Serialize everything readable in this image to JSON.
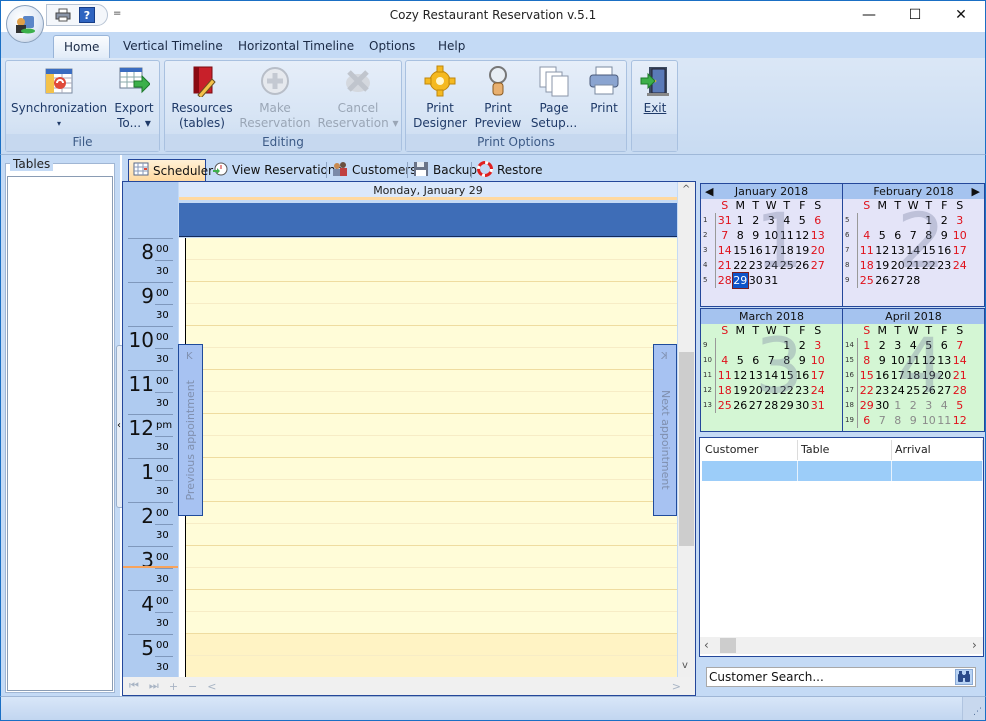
{
  "window": {
    "title": "Cozy Restaurant Reservation v.5.1",
    "controls": {
      "minimize": "—",
      "maximize": "☐",
      "close": "✕"
    }
  },
  "quick_access": {
    "icons": [
      "print-icon",
      "help-icon"
    ],
    "help_glyph": "?",
    "more_glyph": "="
  },
  "menu_tabs": [
    {
      "label": "Home",
      "active": true
    },
    {
      "label": "Vertical Timeline"
    },
    {
      "label": "Horizontal Timeline"
    },
    {
      "label": "Options"
    },
    {
      "label": "Help"
    }
  ],
  "ribbon": {
    "groups": [
      {
        "label": "File",
        "buttons": [
          {
            "line1": "Synchronization",
            "line2": "▾",
            "icon": "sync-table-icon",
            "enabled": true
          },
          {
            "line1": "Export",
            "line2": "To... ▾",
            "icon": "export-icon",
            "enabled": true
          }
        ]
      },
      {
        "label": "Editing",
        "buttons": [
          {
            "line1": "Resources",
            "line2": "(tables)",
            "icon": "resources-book-icon",
            "enabled": true
          },
          {
            "line1": "Make",
            "line2": "Reservation",
            "icon": "plus-circle-icon",
            "enabled": false
          },
          {
            "line1": "Cancel",
            "line2": "Reservation ▾",
            "icon": "cancel-x-icon",
            "enabled": false
          }
        ]
      },
      {
        "label": "Print Options",
        "buttons": [
          {
            "line1": "Print",
            "line2": "Designer",
            "icon": "gear-icon",
            "enabled": true
          },
          {
            "line1": "Print",
            "line2": "Preview",
            "icon": "magnifier-icon",
            "enabled": true
          },
          {
            "line1": "Page",
            "line2": "Setup...",
            "icon": "pages-icon",
            "enabled": true
          },
          {
            "line1": "Print",
            "line2": "",
            "icon": "printer-icon",
            "enabled": true
          }
        ]
      },
      {
        "label": "",
        "buttons": [
          {
            "line1": "Exit",
            "line2": "",
            "icon": "exit-door-icon",
            "enabled": true
          }
        ]
      }
    ]
  },
  "left_panel": {
    "title": "Tables",
    "items": []
  },
  "doc_tabs": [
    {
      "label": "Scheduler",
      "icon": "calendar-grid-icon",
      "active": true
    },
    {
      "label": "View Reservations",
      "icon": "clock-arrow-icon"
    },
    {
      "label": "Customers",
      "icon": "people-icon"
    },
    {
      "label": "Backup",
      "icon": "floppy-icon"
    },
    {
      "label": "Restore",
      "icon": "lifebuoy-icon"
    }
  ],
  "scheduler": {
    "day_header": "Monday, January 29",
    "hours": [
      {
        "hour": "8",
        "sub": "00"
      },
      {
        "hour": "9",
        "sub": "00"
      },
      {
        "hour": "10",
        "sub": "00"
      },
      {
        "hour": "11",
        "sub": "00"
      },
      {
        "hour": "12",
        "sub": "pm"
      },
      {
        "hour": "1",
        "sub": "00"
      },
      {
        "hour": "2",
        "sub": "00"
      },
      {
        "hour": "3",
        "sub": "00"
      },
      {
        "hour": "4",
        "sub": "00"
      },
      {
        "hour": "5",
        "sub": "00"
      }
    ],
    "half_label": "30",
    "current_time": "3:30",
    "prev_appointment": "Previous appointment",
    "next_appointment": "Next appointment",
    "prev_glyph": "K",
    "next_glyph": "K",
    "nav": [
      "⏮",
      "⏭",
      "+",
      "−",
      "<"
    ],
    "scroll_up": "^",
    "scroll_down": "v",
    "nav_right": ">"
  },
  "calendars": [
    {
      "title": "January 2018",
      "bigmonth": "1",
      "bg": "#e4e4f8",
      "nav_prev": "◀",
      "weeks": [
        {
          "n": "1",
          "days": [
            [
              "31",
              "r"
            ],
            [
              "1",
              ""
            ],
            [
              "2",
              ""
            ],
            [
              "3",
              ""
            ],
            [
              "4",
              ""
            ],
            [
              "5",
              ""
            ],
            [
              "6",
              "r"
            ]
          ]
        },
        {
          "n": "2",
          "days": [
            [
              "7",
              "r"
            ],
            [
              "8",
              ""
            ],
            [
              "9",
              ""
            ],
            [
              "10",
              ""
            ],
            [
              "11",
              ""
            ],
            [
              "12",
              ""
            ],
            [
              "13",
              "r"
            ]
          ]
        },
        {
          "n": "3",
          "days": [
            [
              "14",
              "r"
            ],
            [
              "15",
              ""
            ],
            [
              "16",
              ""
            ],
            [
              "17",
              ""
            ],
            [
              "18",
              ""
            ],
            [
              "19",
              ""
            ],
            [
              "20",
              "r"
            ]
          ]
        },
        {
          "n": "4",
          "days": [
            [
              "21",
              "r"
            ],
            [
              "22",
              ""
            ],
            [
              "23",
              ""
            ],
            [
              "24",
              ""
            ],
            [
              "25",
              ""
            ],
            [
              "26",
              ""
            ],
            [
              "27",
              "r"
            ]
          ]
        },
        {
          "n": "5",
          "days": [
            [
              "28",
              "r"
            ],
            [
              "29",
              "sel"
            ],
            [
              "30",
              ""
            ],
            [
              "31",
              ""
            ],
            [
              "",
              ""
            ],
            [
              "",
              ""
            ],
            [
              "",
              ""
            ]
          ]
        }
      ]
    },
    {
      "title": "February 2018",
      "bigmonth": "2",
      "bg": "#e4e4f8",
      "nav_next": "▶",
      "weeks": [
        {
          "n": "5",
          "days": [
            [
              "",
              ""
            ],
            [
              "",
              ""
            ],
            [
              "",
              ""
            ],
            [
              "",
              ""
            ],
            [
              "1",
              ""
            ],
            [
              "2",
              ""
            ],
            [
              "3",
              "r"
            ]
          ]
        },
        {
          "n": "6",
          "days": [
            [
              "4",
              "r"
            ],
            [
              "5",
              ""
            ],
            [
              "6",
              ""
            ],
            [
              "7",
              ""
            ],
            [
              "8",
              ""
            ],
            [
              "9",
              ""
            ],
            [
              "10",
              "r"
            ]
          ]
        },
        {
          "n": "7",
          "days": [
            [
              "11",
              "r"
            ],
            [
              "12",
              ""
            ],
            [
              "13",
              ""
            ],
            [
              "14",
              ""
            ],
            [
              "15",
              ""
            ],
            [
              "16",
              ""
            ],
            [
              "17",
              "r"
            ]
          ]
        },
        {
          "n": "8",
          "days": [
            [
              "18",
              "r"
            ],
            [
              "19",
              ""
            ],
            [
              "20",
              ""
            ],
            [
              "21",
              ""
            ],
            [
              "22",
              ""
            ],
            [
              "23",
              ""
            ],
            [
              "24",
              "r"
            ]
          ]
        },
        {
          "n": "9",
          "days": [
            [
              "25",
              "r"
            ],
            [
              "26",
              ""
            ],
            [
              "27",
              ""
            ],
            [
              "28",
              ""
            ],
            [
              "",
              ""
            ],
            [
              "",
              ""
            ],
            [
              "",
              ""
            ]
          ]
        }
      ]
    },
    {
      "title": "March 2018",
      "bigmonth": "3",
      "bg": "#d4f6d4",
      "weeks": [
        {
          "n": "9",
          "days": [
            [
              "",
              ""
            ],
            [
              "",
              ""
            ],
            [
              "",
              ""
            ],
            [
              "",
              ""
            ],
            [
              "1",
              ""
            ],
            [
              "2",
              ""
            ],
            [
              "3",
              "r"
            ]
          ]
        },
        {
          "n": "10",
          "days": [
            [
              "4",
              "r"
            ],
            [
              "5",
              ""
            ],
            [
              "6",
              ""
            ],
            [
              "7",
              ""
            ],
            [
              "8",
              ""
            ],
            [
              "9",
              ""
            ],
            [
              "10",
              "r"
            ]
          ]
        },
        {
          "n": "11",
          "days": [
            [
              "11",
              "r"
            ],
            [
              "12",
              ""
            ],
            [
              "13",
              ""
            ],
            [
              "14",
              ""
            ],
            [
              "15",
              ""
            ],
            [
              "16",
              ""
            ],
            [
              "17",
              "r"
            ]
          ]
        },
        {
          "n": "12",
          "days": [
            [
              "18",
              "r"
            ],
            [
              "19",
              ""
            ],
            [
              "20",
              ""
            ],
            [
              "21",
              ""
            ],
            [
              "22",
              ""
            ],
            [
              "23",
              ""
            ],
            [
              "24",
              "r"
            ]
          ]
        },
        {
          "n": "13",
          "days": [
            [
              "25",
              "r"
            ],
            [
              "26",
              ""
            ],
            [
              "27",
              ""
            ],
            [
              "28",
              ""
            ],
            [
              "29",
              ""
            ],
            [
              "30",
              ""
            ],
            [
              "31",
              "r"
            ]
          ]
        }
      ]
    },
    {
      "title": "April 2018",
      "bigmonth": "4",
      "bg": "#d4f6d4",
      "weeks": [
        {
          "n": "14",
          "days": [
            [
              "1",
              "r"
            ],
            [
              "2",
              ""
            ],
            [
              "3",
              ""
            ],
            [
              "4",
              ""
            ],
            [
              "5",
              ""
            ],
            [
              "6",
              ""
            ],
            [
              "7",
              "r"
            ]
          ]
        },
        {
          "n": "15",
          "days": [
            [
              "8",
              "r"
            ],
            [
              "9",
              ""
            ],
            [
              "10",
              ""
            ],
            [
              "11",
              ""
            ],
            [
              "12",
              ""
            ],
            [
              "13",
              ""
            ],
            [
              "14",
              "r"
            ]
          ]
        },
        {
          "n": "16",
          "days": [
            [
              "15",
              "r"
            ],
            [
              "16",
              ""
            ],
            [
              "17",
              ""
            ],
            [
              "18",
              ""
            ],
            [
              "19",
              ""
            ],
            [
              "20",
              ""
            ],
            [
              "21",
              "r"
            ]
          ]
        },
        {
          "n": "17",
          "days": [
            [
              "22",
              "r"
            ],
            [
              "23",
              ""
            ],
            [
              "24",
              ""
            ],
            [
              "25",
              ""
            ],
            [
              "26",
              ""
            ],
            [
              "27",
              ""
            ],
            [
              "28",
              "r"
            ]
          ]
        },
        {
          "n": "18",
          "days": [
            [
              "29",
              "r"
            ],
            [
              "30",
              ""
            ],
            [
              "1",
              "g"
            ],
            [
              "2",
              "g"
            ],
            [
              "3",
              "g"
            ],
            [
              "4",
              "g"
            ],
            [
              "5",
              "r"
            ]
          ]
        },
        {
          "n": "19",
          "days": [
            [
              "6",
              "r"
            ],
            [
              "7",
              "g"
            ],
            [
              "8",
              "g"
            ],
            [
              "9",
              "g"
            ],
            [
              "10",
              "g"
            ],
            [
              "11",
              "g"
            ],
            [
              "12",
              "r"
            ]
          ]
        }
      ]
    }
  ],
  "dow": [
    "S",
    "M",
    "T",
    "W",
    "T",
    "F",
    "S"
  ],
  "customer_grid": {
    "columns": [
      "Customer",
      "Table",
      "Arrival"
    ],
    "rows": [
      [
        "",
        "",
        ""
      ]
    ]
  },
  "search": {
    "placeholder": "Customer Search...",
    "icon": "binoculars-icon"
  },
  "colors": {
    "accent": "#1a6fc4",
    "ribbon_bg": "#c4daf5",
    "allday": "#3e6db7",
    "grid_work": "#fffcd8",
    "grid_offhours": "#fff3c4",
    "weekend": "#e0101a",
    "selected_day": "#0f54c8",
    "current_time": "#f7a35c"
  }
}
